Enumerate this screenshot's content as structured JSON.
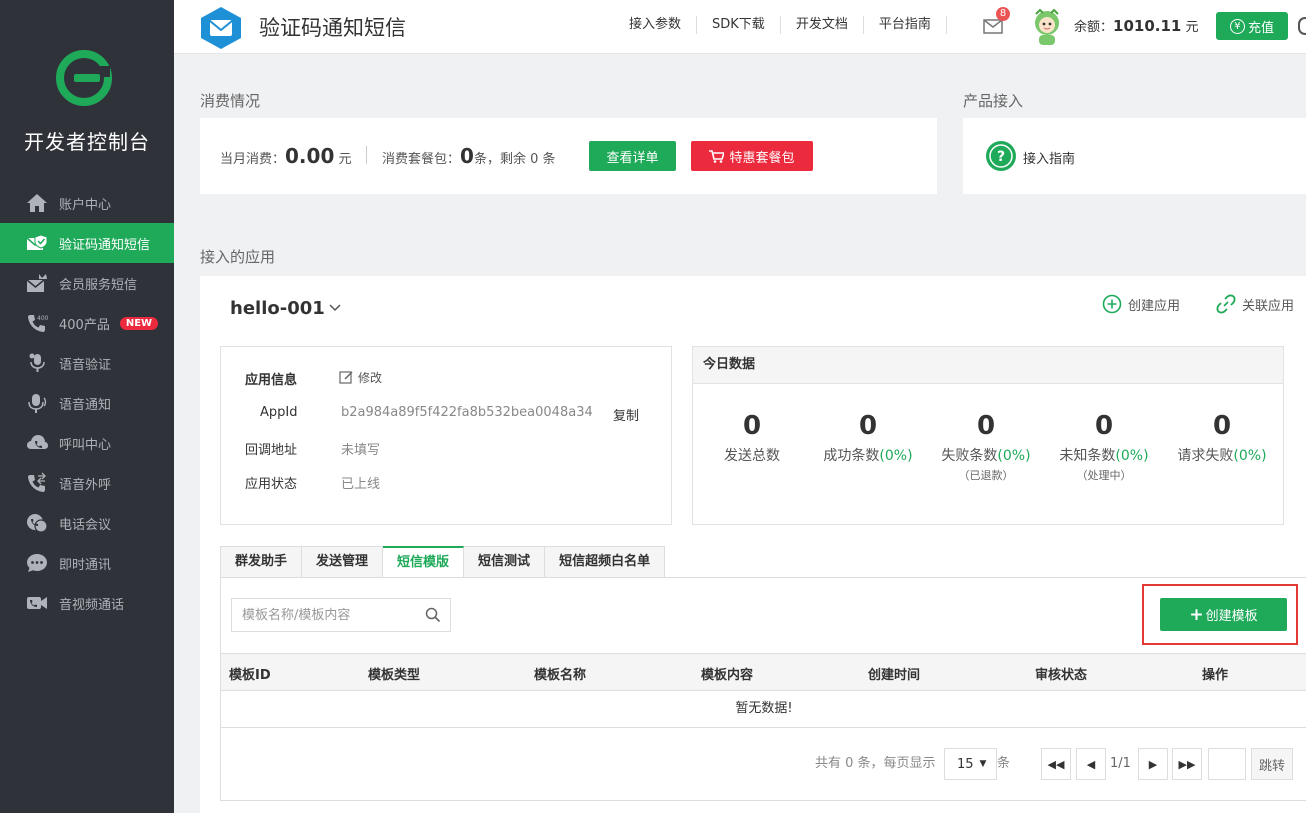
{
  "sidebar": {
    "brand": "开发者控制台",
    "items": [
      {
        "label": "账户中心",
        "icon": "home-icon"
      },
      {
        "label": "验证码通知短信",
        "icon": "sms-verify-icon"
      },
      {
        "label": "会员服务短信",
        "icon": "sms-member-icon"
      },
      {
        "label": "400产品",
        "icon": "phone-400-icon",
        "badge": "NEW"
      },
      {
        "label": "语音验证",
        "icon": "voice-verify-icon"
      },
      {
        "label": "语音通知",
        "icon": "microphone-icon"
      },
      {
        "label": "呼叫中心",
        "icon": "call-center-icon"
      },
      {
        "label": "语音外呼",
        "icon": "outbound-call-icon"
      },
      {
        "label": "电话会议",
        "icon": "conference-icon"
      },
      {
        "label": "即时通讯",
        "icon": "chat-icon"
      },
      {
        "label": "音视频通话",
        "icon": "video-call-icon"
      }
    ],
    "active_index": 1
  },
  "header": {
    "title": "验证码通知短信",
    "links": [
      "接入参数",
      "SDK下载",
      "开发文档",
      "平台指南"
    ],
    "mail_count": "8",
    "balance_label": "余额：",
    "balance_value": "1010.11",
    "balance_unit": "元",
    "recharge_icon": "¥",
    "recharge_label": "充值"
  },
  "consume": {
    "section_title": "消费情况",
    "month_label": "当月消费：",
    "month_value": "0.00",
    "month_unit": "元",
    "package_label": "消费套餐包：",
    "package_value": "0",
    "package_suffix": "条，剩余 0 条",
    "detail_button": "查看详单",
    "special_button": "特惠套餐包"
  },
  "product": {
    "section_title": "产品接入",
    "guide_label": "接入指南"
  },
  "apps": {
    "section_title": "接入的应用",
    "app_name": "hello-001",
    "create_app": "创建应用",
    "link_app": "关联应用",
    "info": {
      "title": "应用信息",
      "edit": "修改",
      "appid_label": "AppId",
      "appid_value": "b2a984a89f5f422fa8b532bea0048a34",
      "copy": "复制",
      "callback_label": "回调地址",
      "callback_value": "未填写",
      "status_label": "应用状态",
      "status_value": "已上线"
    },
    "today": {
      "title": "今日数据",
      "stats": [
        {
          "num": "0",
          "label": "发送总数",
          "pct": "",
          "sub": ""
        },
        {
          "num": "0",
          "label": "成功条数",
          "pct": "(0%)",
          "sub": ""
        },
        {
          "num": "0",
          "label": "失败条数",
          "pct": "(0%)",
          "sub": "（已退款）"
        },
        {
          "num": "0",
          "label": "未知条数",
          "pct": "(0%)",
          "sub": "（处理中）"
        },
        {
          "num": "0",
          "label": "请求失败",
          "pct": "(0%)",
          "sub": ""
        }
      ]
    },
    "tabs": [
      "群发助手",
      "发送管理",
      "短信模版",
      "短信测试",
      "短信超频白名单"
    ],
    "active_tab": 2,
    "search_placeholder": "模板名称/模板内容",
    "create_template": "创建模板",
    "columns": [
      "模板ID",
      "模板类型",
      "模板名称",
      "模板内容",
      "创建时间",
      "审核状态",
      "操作"
    ],
    "empty_text": "暂无数据!",
    "pager": {
      "total_text": "共有 0 条，每页显示",
      "page_size": "15",
      "unit": "条",
      "page_info": "1/1",
      "goto": "跳转"
    }
  }
}
